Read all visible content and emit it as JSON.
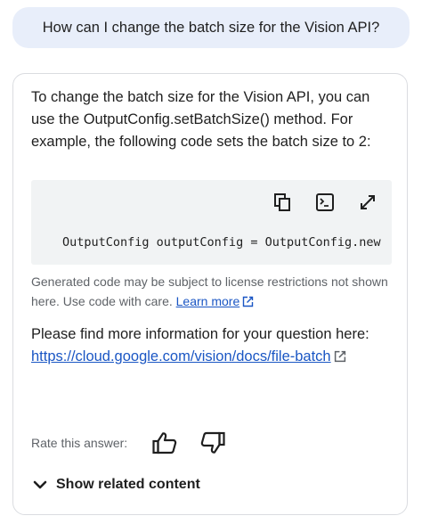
{
  "user_question": "How can I change the batch size for the Vision API?",
  "answer": {
    "intro": "To change the batch size for the Vision API, you can use the OutputConfig.setBatchSize() method. For example, the following code sets the batch size to 2:",
    "code_line": "OutputConfig outputConfig = OutputConfig.new",
    "code_toolbar": {
      "copy_icon": "copy-icon",
      "terminal_icon": "terminal-icon",
      "expand_icon": "expand-icon"
    },
    "disclaimer": "Generated code may be subject to license restrictions not shown here. Use code with care.",
    "learn_more": "Learn more",
    "more_info_text": "Please find more information for your question here:",
    "more_info_link": "https://cloud.google.com/vision/docs/file-batch"
  },
  "rating": {
    "label": "Rate this answer:",
    "thumbs_up_icon": "thumbs-up-icon",
    "thumbs_down_icon": "thumbs-down-icon"
  },
  "related": {
    "label": "Show related content",
    "icon": "chevron-down-icon"
  },
  "colors": {
    "user_bubble": "#e8eefa",
    "link": "#1a56c4",
    "code_bg": "#f1f3f4"
  }
}
